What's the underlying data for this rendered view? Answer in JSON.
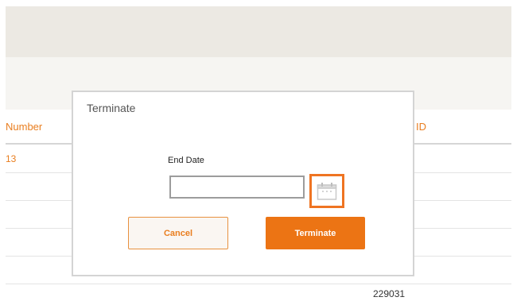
{
  "table": {
    "headers": {
      "number": "Number",
      "id": "ID"
    },
    "rows": [
      {
        "number": "13"
      }
    ],
    "footer_value": "229031"
  },
  "modal": {
    "title": "Terminate",
    "end_date_label": "End Date",
    "end_date_value": "",
    "calendar_icon": "calendar-icon",
    "cancel_label": "Cancel",
    "terminate_label": "Terminate"
  },
  "colors": {
    "accent": "#ec7414",
    "header_text": "#e97e1f",
    "top_band": "#ece9e3"
  }
}
